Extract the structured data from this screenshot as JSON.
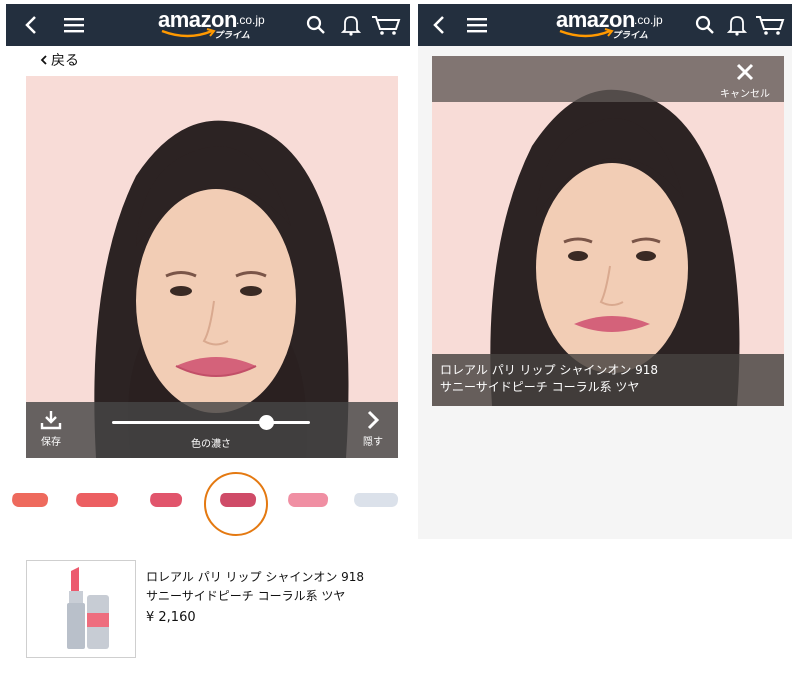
{
  "left_screen": {
    "header": {
      "logo_word": "amazon",
      "logo_tld": ".co.jp",
      "logo_prime": "プライム"
    },
    "back_label": "戻る",
    "controls": {
      "save_label": "保存",
      "intensity_label": "色の濃さ",
      "hide_label": "隠す",
      "intensity_value": 0.78
    },
    "swatches": [
      {
        "color": "#ee6a5d"
      },
      {
        "color": "#ec5f62"
      },
      {
        "color": "#e1556c"
      },
      {
        "color": "#cf4b68",
        "selected": true
      },
      {
        "color": "#f08fa3"
      },
      {
        "color": "#dbe1ea"
      }
    ],
    "product": {
      "name_line1": "ロレアル パリ リップ シャインオン 918",
      "name_line2": "サニーサイドピーチ コーラル系 ツヤ",
      "price": "¥ 2,160"
    }
  },
  "right_screen": {
    "header": {
      "logo_word": "amazon",
      "logo_tld": ".co.jp",
      "logo_prime": "プライム"
    },
    "cancel_label": "キャンセル",
    "caption_line1": "ロレアル パリ リップ シャインオン 918",
    "caption_line2": "サニーサイドピーチ コーラル系 ツヤ"
  },
  "colors": {
    "header_bg": "#232f3e",
    "accent_orange": "#e47911",
    "photo_bg": "#f8dcd7",
    "lip": "#d4627a"
  }
}
